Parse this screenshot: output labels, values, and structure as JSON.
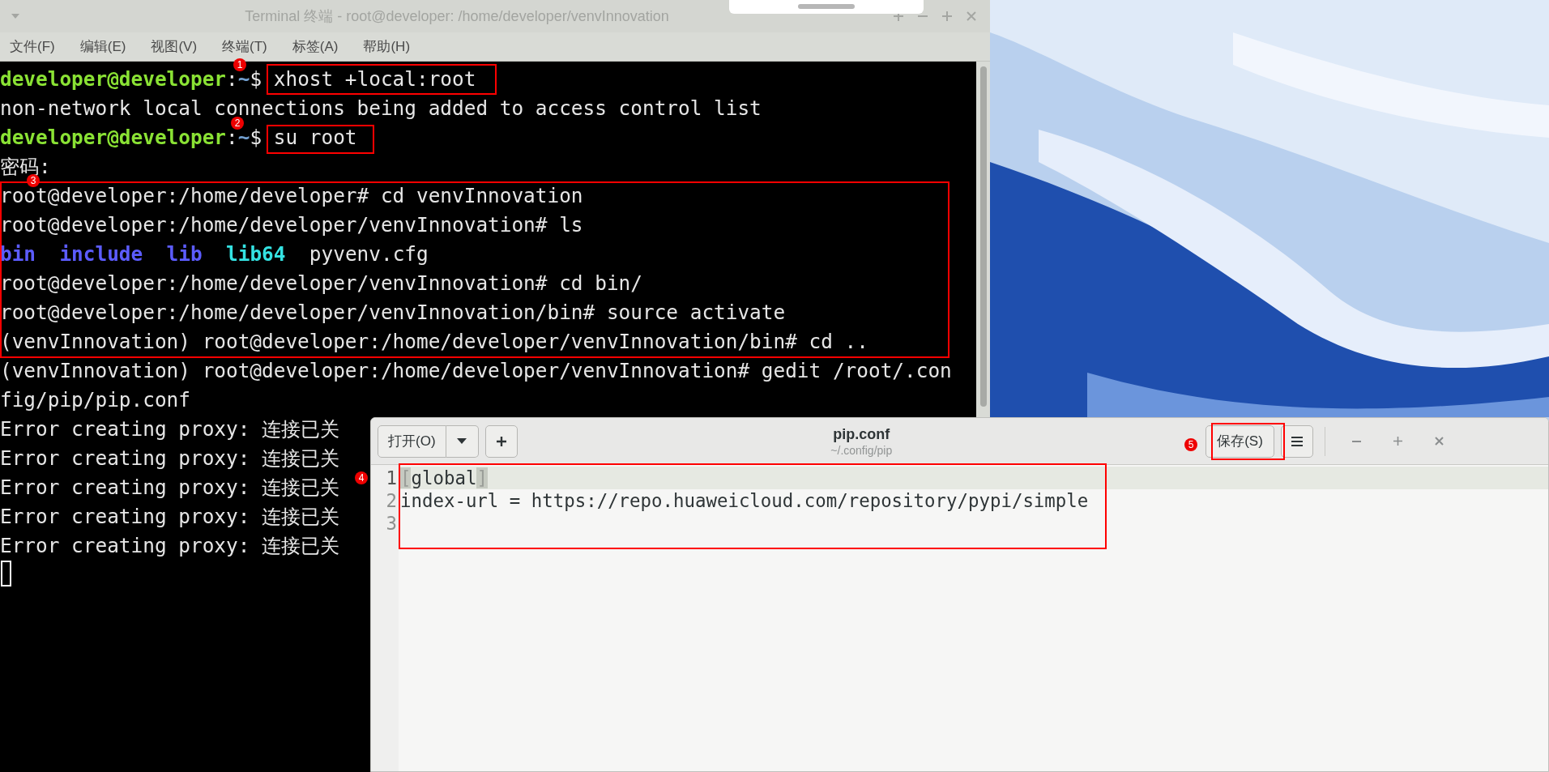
{
  "terminal": {
    "title": "Terminal 终端 - root@developer: /home/developer/venvInnovation",
    "menu": [
      "文件(F)",
      "编辑(E)",
      "视图(V)",
      "终端(T)",
      "标签(A)",
      "帮助(H)"
    ],
    "lines": [
      {
        "segments": [
          {
            "kind": "user",
            "text": "developer@developer"
          },
          {
            "kind": "plain",
            "text": ":"
          },
          {
            "kind": "path",
            "text": "~"
          },
          {
            "kind": "plain",
            "text": "$"
          }
        ],
        "command": "xhost +local:root"
      },
      {
        "segments": [
          {
            "kind": "plain",
            "text": "non-network local connections being added to access control list"
          }
        ]
      },
      {
        "segments": [
          {
            "kind": "user",
            "text": "developer@developer"
          },
          {
            "kind": "plain",
            "text": ":"
          },
          {
            "kind": "path",
            "text": "~"
          },
          {
            "kind": "plain",
            "text": "$"
          }
        ],
        "command": "su root"
      },
      {
        "segments": [
          {
            "kind": "plain",
            "text": "密码:"
          }
        ]
      },
      {
        "segments": [
          {
            "kind": "plain",
            "text": "root@developer:/home/developer# cd venvInnovation"
          }
        ]
      },
      {
        "segments": [
          {
            "kind": "plain",
            "text": "root@developer:/home/developer/venvInnovation# ls"
          }
        ]
      },
      {
        "segments": [
          {
            "kind": "dir",
            "text": "bin"
          },
          {
            "kind": "dir",
            "text": "  include"
          },
          {
            "kind": "dir",
            "text": "  lib"
          },
          {
            "kind": "exec",
            "text": "  lib64"
          },
          {
            "kind": "plain",
            "text": "  pyvenv.cfg"
          }
        ]
      },
      {
        "segments": [
          {
            "kind": "plain",
            "text": "root@developer:/home/developer/venvInnovation# cd bin/"
          }
        ]
      },
      {
        "segments": [
          {
            "kind": "plain",
            "text": "root@developer:/home/developer/venvInnovation/bin# source activate"
          }
        ]
      },
      {
        "segments": [
          {
            "kind": "plain",
            "text": "(venvInnovation) root@developer:/home/developer/venvInnovation/bin# cd .."
          }
        ]
      },
      {
        "segments": [
          {
            "kind": "plain",
            "text": "(venvInnovation) root@developer:/home/developer/venvInnovation# gedit /root/.con"
          }
        ]
      },
      {
        "segments": [
          {
            "kind": "plain",
            "text": "fig/pip/pip.conf"
          }
        ]
      },
      {
        "segments": [
          {
            "kind": "plain",
            "text": "Error creating proxy: 连接已关"
          }
        ]
      },
      {
        "segments": [
          {
            "kind": "plain",
            "text": "Error creating proxy: 连接已关"
          }
        ]
      },
      {
        "segments": [
          {
            "kind": "plain",
            "text": "Error creating proxy: 连接已关"
          }
        ]
      },
      {
        "segments": [
          {
            "kind": "plain",
            "text": "Error creating proxy: 连接已关"
          }
        ]
      },
      {
        "segments": [
          {
            "kind": "plain",
            "text": "Error creating proxy: 连接已关"
          }
        ]
      }
    ]
  },
  "editor": {
    "open_button": "打开(O)",
    "title": "pip.conf",
    "subtitle": "~/.config/pip",
    "save_button": "保存(S)",
    "lines": [
      {
        "number": "1",
        "current": true,
        "segments": [
          {
            "text": "[",
            "matched": true
          },
          {
            "text": "global",
            "matched": false
          },
          {
            "text": "]",
            "matched": true
          }
        ]
      },
      {
        "number": "2",
        "current": false,
        "segments": [
          {
            "text": "index-url = https://repo.huaweicloud.com/repository/pypi/simple",
            "matched": false
          }
        ]
      },
      {
        "number": "3",
        "current": false
      }
    ]
  },
  "annotations": [
    {
      "label": "1"
    },
    {
      "label": "2"
    },
    {
      "label": "3"
    },
    {
      "label": "4"
    },
    {
      "label": "5"
    }
  ]
}
